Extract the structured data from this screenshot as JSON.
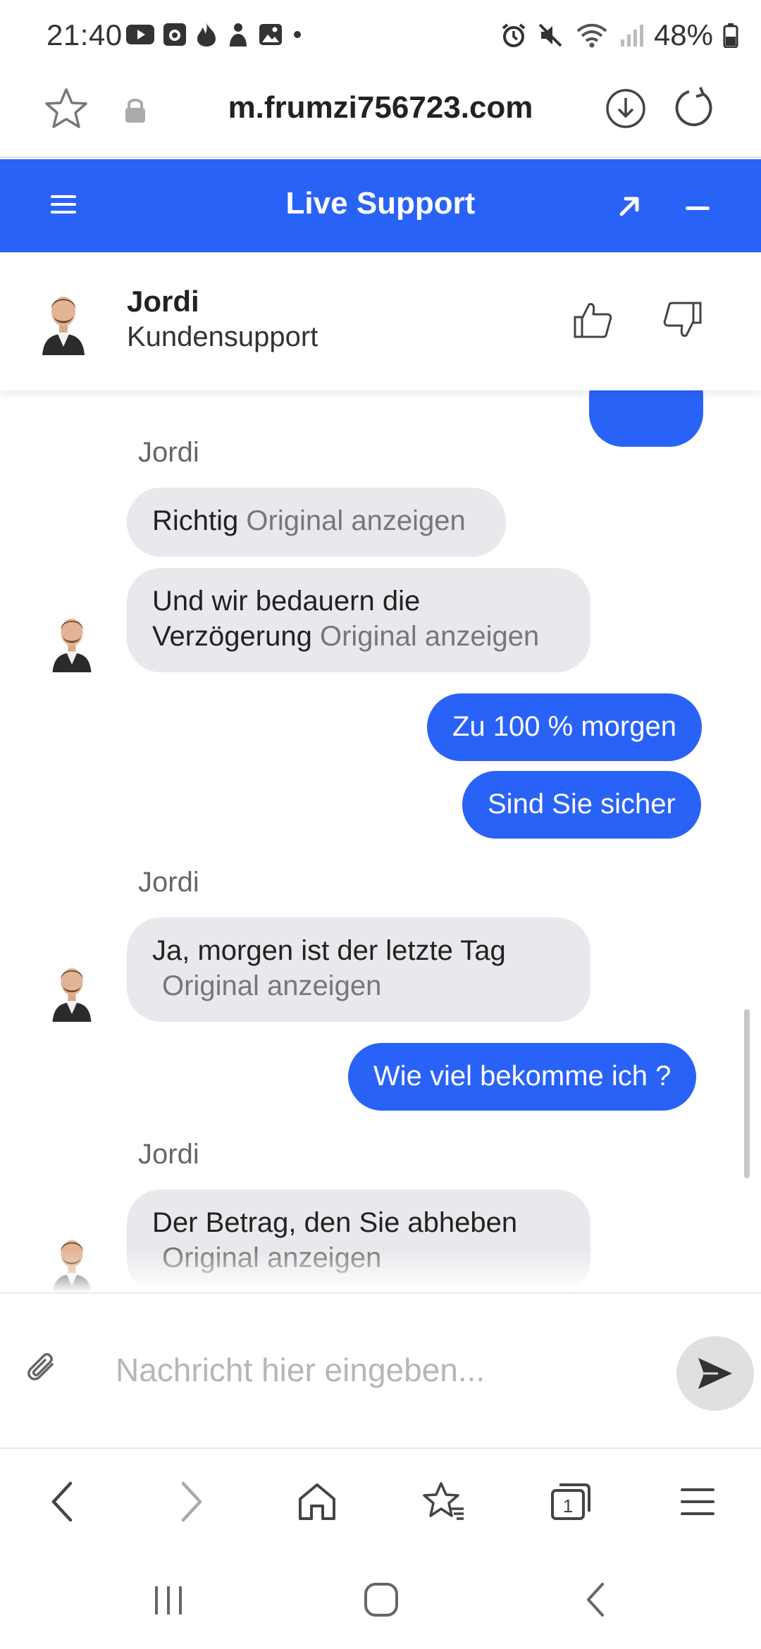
{
  "status_bar": {
    "time": "21:40",
    "battery": "48%",
    "app_icons": [
      "youtube-icon",
      "camera-app-icon",
      "tinder-flame-icon",
      "game-icon",
      "gallery-icon",
      "dot-icon"
    ],
    "right_icons": [
      "alarm-icon",
      "mute-icon",
      "wifi-icon",
      "signal-icon",
      "battery-icon"
    ]
  },
  "browser": {
    "url": "m.frumzi756723.com"
  },
  "header": {
    "title": "Live Support"
  },
  "agent": {
    "name": "Jordi",
    "role": "Kundensupport"
  },
  "messages": {
    "sender_1": "Jordi",
    "in_1_text": "Richtig",
    "in_1_original": "Original anzeigen",
    "in_2_line1": "Und wir bedauern die",
    "in_2_line2": "Verzögerung",
    "in_2_original": "Original anzeigen",
    "out_1": "Zu 100 % morgen",
    "out_2": "Sind Sie sicher",
    "sender_2": "Jordi",
    "in_3_text": "Ja, morgen ist der letzte Tag",
    "in_3_original": "Original anzeigen",
    "out_3": "Wie viel bekomme ich ?",
    "sender_3": "Jordi",
    "in_4_text": "Der Betrag, den Sie abheben",
    "in_4_original": "Original anzeigen"
  },
  "input": {
    "placeholder": "Nachricht hier eingeben..."
  },
  "browser_nav": {
    "tab_count": "1"
  },
  "colors": {
    "accent": "#2962f6",
    "bubble_incoming": "#e8e9ec",
    "muted_text": "#777777"
  }
}
